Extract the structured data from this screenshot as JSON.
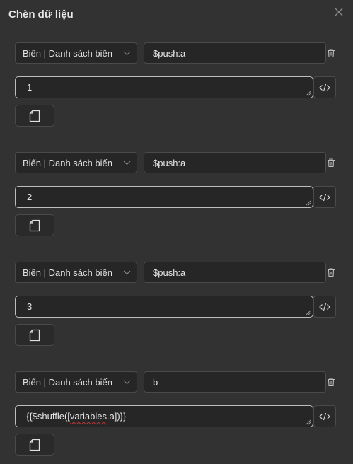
{
  "dialog": {
    "title": "Chèn dữ liệu"
  },
  "rows": [
    {
      "type_label": "Biến | Danh sách biến",
      "name": "$push:a",
      "value": "1"
    },
    {
      "type_label": "Biến | Danh sách biến",
      "name": "$push:a",
      "value": "2"
    },
    {
      "type_label": "Biến | Danh sách biến",
      "name": "$push:a",
      "value": "3"
    },
    {
      "type_label": "Biến | Danh sách biến",
      "name": "b",
      "value_prefix": "{{$shuffle([",
      "value_mid": "variables",
      "value_suffix": ".a])}}"
    }
  ],
  "icons": {
    "close": "close-icon",
    "caret": "chevron-down-icon",
    "delete": "trash-icon",
    "code": "code-icon",
    "file": "file-icon"
  }
}
